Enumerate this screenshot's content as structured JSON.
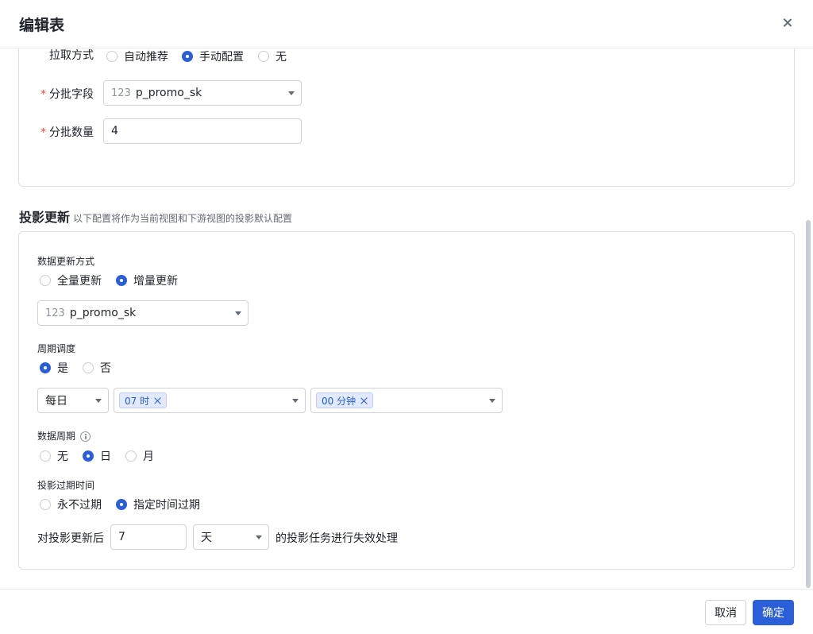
{
  "dialog": {
    "title": "编辑表"
  },
  "partition": {
    "fetch_label": "拉取方式",
    "fetch_options": [
      "自动推荐",
      "手动配置",
      "无"
    ],
    "fetch_selected": 1,
    "batch_field_label": "分批字段",
    "batch_field_type": "123",
    "batch_field_value": "p_promo_sk",
    "batch_count_label": "分批数量",
    "batch_count_value": "4",
    "required_mark": "*"
  },
  "projection": {
    "title": "投影更新",
    "desc": "以下配置将作为当前视图和下游视图的投影默认配置",
    "update_mode_label": "数据更新方式",
    "update_mode_options": [
      "全量更新",
      "增量更新"
    ],
    "update_mode_selected": 1,
    "incr_field_type": "123",
    "incr_field_value": "p_promo_sk",
    "schedule_label": "周期调度",
    "schedule_options": [
      "是",
      "否"
    ],
    "schedule_selected": 0,
    "frequency": "每日",
    "hour_chip": "07 时",
    "minute_chip": "00 分钟",
    "data_period_label": "数据周期",
    "data_period_options": [
      "无",
      "日",
      "月"
    ],
    "data_period_selected": 1,
    "expire_label": "投影过期时间",
    "expire_options": [
      "永不过期",
      "指定时间过期"
    ],
    "expire_selected": 1,
    "expire_prefix": "对投影更新后",
    "expire_value": "7",
    "expire_unit": "天",
    "expire_suffix": "的投影任务进行失效处理"
  },
  "footer": {
    "cancel": "取消",
    "ok": "确定"
  },
  "colors": {
    "primary": "#2b5fd9",
    "required": "#f54a45",
    "border": "#dee0e3"
  }
}
